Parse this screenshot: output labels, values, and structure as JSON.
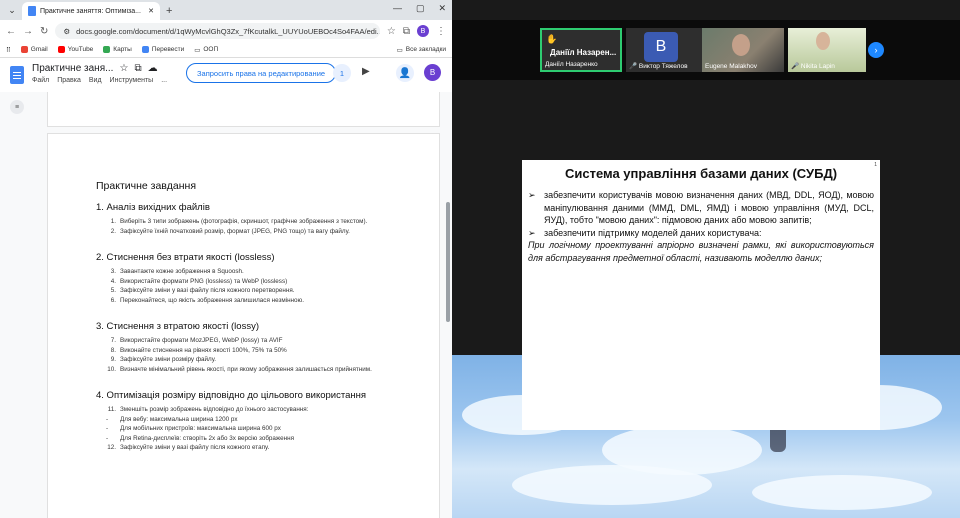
{
  "browser": {
    "tab_title": "Практичне заняття: Оптиміза...",
    "url": "docs.google.com/document/d/1qWyMcvlGhQ3Zx_7fKcutalkL_UUYUoUEBOc4So4FAA/edi...",
    "profile_initial": "B",
    "bookmarks": [
      "Gmail",
      "YouTube",
      "Карты",
      "Перевести",
      "ООП"
    ],
    "all_bookmarks": "Все закладки"
  },
  "docs": {
    "title": "Практичне заня...",
    "menu": [
      "Файл",
      "Правка",
      "Вид",
      "Инструменты",
      "..."
    ],
    "request_button": "Запросить права на редактирование",
    "viewer_count": "1",
    "avatar_initial": "B"
  },
  "doc": {
    "heading": "Практичне завдання",
    "sections": [
      {
        "title": "1. Аналіз вихідних файлів",
        "items": [
          {
            "num": "1.",
            "text": "Виберіть 3 типи зображень (фотографія, скриншот, графічне зображення з текстом)."
          },
          {
            "num": "2.",
            "text": "Зафіксуйте їхній початковий розмір, формат (JPEG, PNG тощо) та вагу файлу."
          }
        ]
      },
      {
        "title": "2. Стиснення без втрати якості (lossless)",
        "items": [
          {
            "num": "3.",
            "text": "Завантажте кожне зображення в Squoosh."
          },
          {
            "num": "4.",
            "text": "Використайте формати PNG (lossless) та WebP (lossless)"
          },
          {
            "num": "5.",
            "text": "Зафіксуйте зміни у вазі файлу після кожного перетворення."
          },
          {
            "num": "6.",
            "text": "Переконайтеся, що якість зображення залишилася незмінною."
          }
        ]
      },
      {
        "title": "3. Стиснення з втратою якості (lossy)",
        "items": [
          {
            "num": "7.",
            "text": "Використайте формати MozJPEG, WebP (lossy) та AVIF"
          },
          {
            "num": "8.",
            "text": "Виконайте стиснення на рівнях якості 100%, 75% та 50%"
          },
          {
            "num": "9.",
            "text": "Зафіксуйте зміни розміру файлу."
          },
          {
            "num": "10.",
            "text": "Визначте мінімальний рівень якості, при якому зображення залишається прийнятним."
          }
        ]
      },
      {
        "title": "4. Оптимізація розміру відповідно до цільового використання",
        "items": [
          {
            "num": "11.",
            "text": "Зменшіть розмір зображень відповідно до їхнього застосування:"
          },
          {
            "num": "-",
            "text": "Для вебу: максимальна ширина 1200 px"
          },
          {
            "num": "-",
            "text": "Для мобільних пристроїв: максимальна ширина 600 px"
          },
          {
            "num": "-",
            "text": "Для Retina-дисплеїв: створіть 2x або 3x версію зображення"
          },
          {
            "num": "12.",
            "text": "Зафіксуйте зміни у вазі файлу після кожного етапу."
          }
        ]
      }
    ]
  },
  "zoom": {
    "participants": [
      {
        "name": "Даніїл Назаренко",
        "label": "Даніїл Назарен..."
      },
      {
        "name": "Виктор Тяжелов",
        "initial": "B"
      },
      {
        "name": "Eugene Malakhov"
      },
      {
        "name": "Nikita Lapin"
      }
    ]
  },
  "slide": {
    "page_num": "1",
    "title": "Система управління базами даних (СУБД)",
    "bullet1": "забезпечити користувачів мовою визначення даних (МВД, DDL, ЯОД), мовою маніпулювання даними (ММД, DML, ЯМД) і мовою управління (МУД, DCL, ЯУД), тобто \"мовою даних\": підмовою даних або мовою запитів;",
    "bullet2": "забезпечити підтримку моделей даних користувача:",
    "paragraph": "При логічному проектуванні апріорно визначені рамки, які використовуються для абстрагування предметної області, називають моделлю даних;"
  }
}
